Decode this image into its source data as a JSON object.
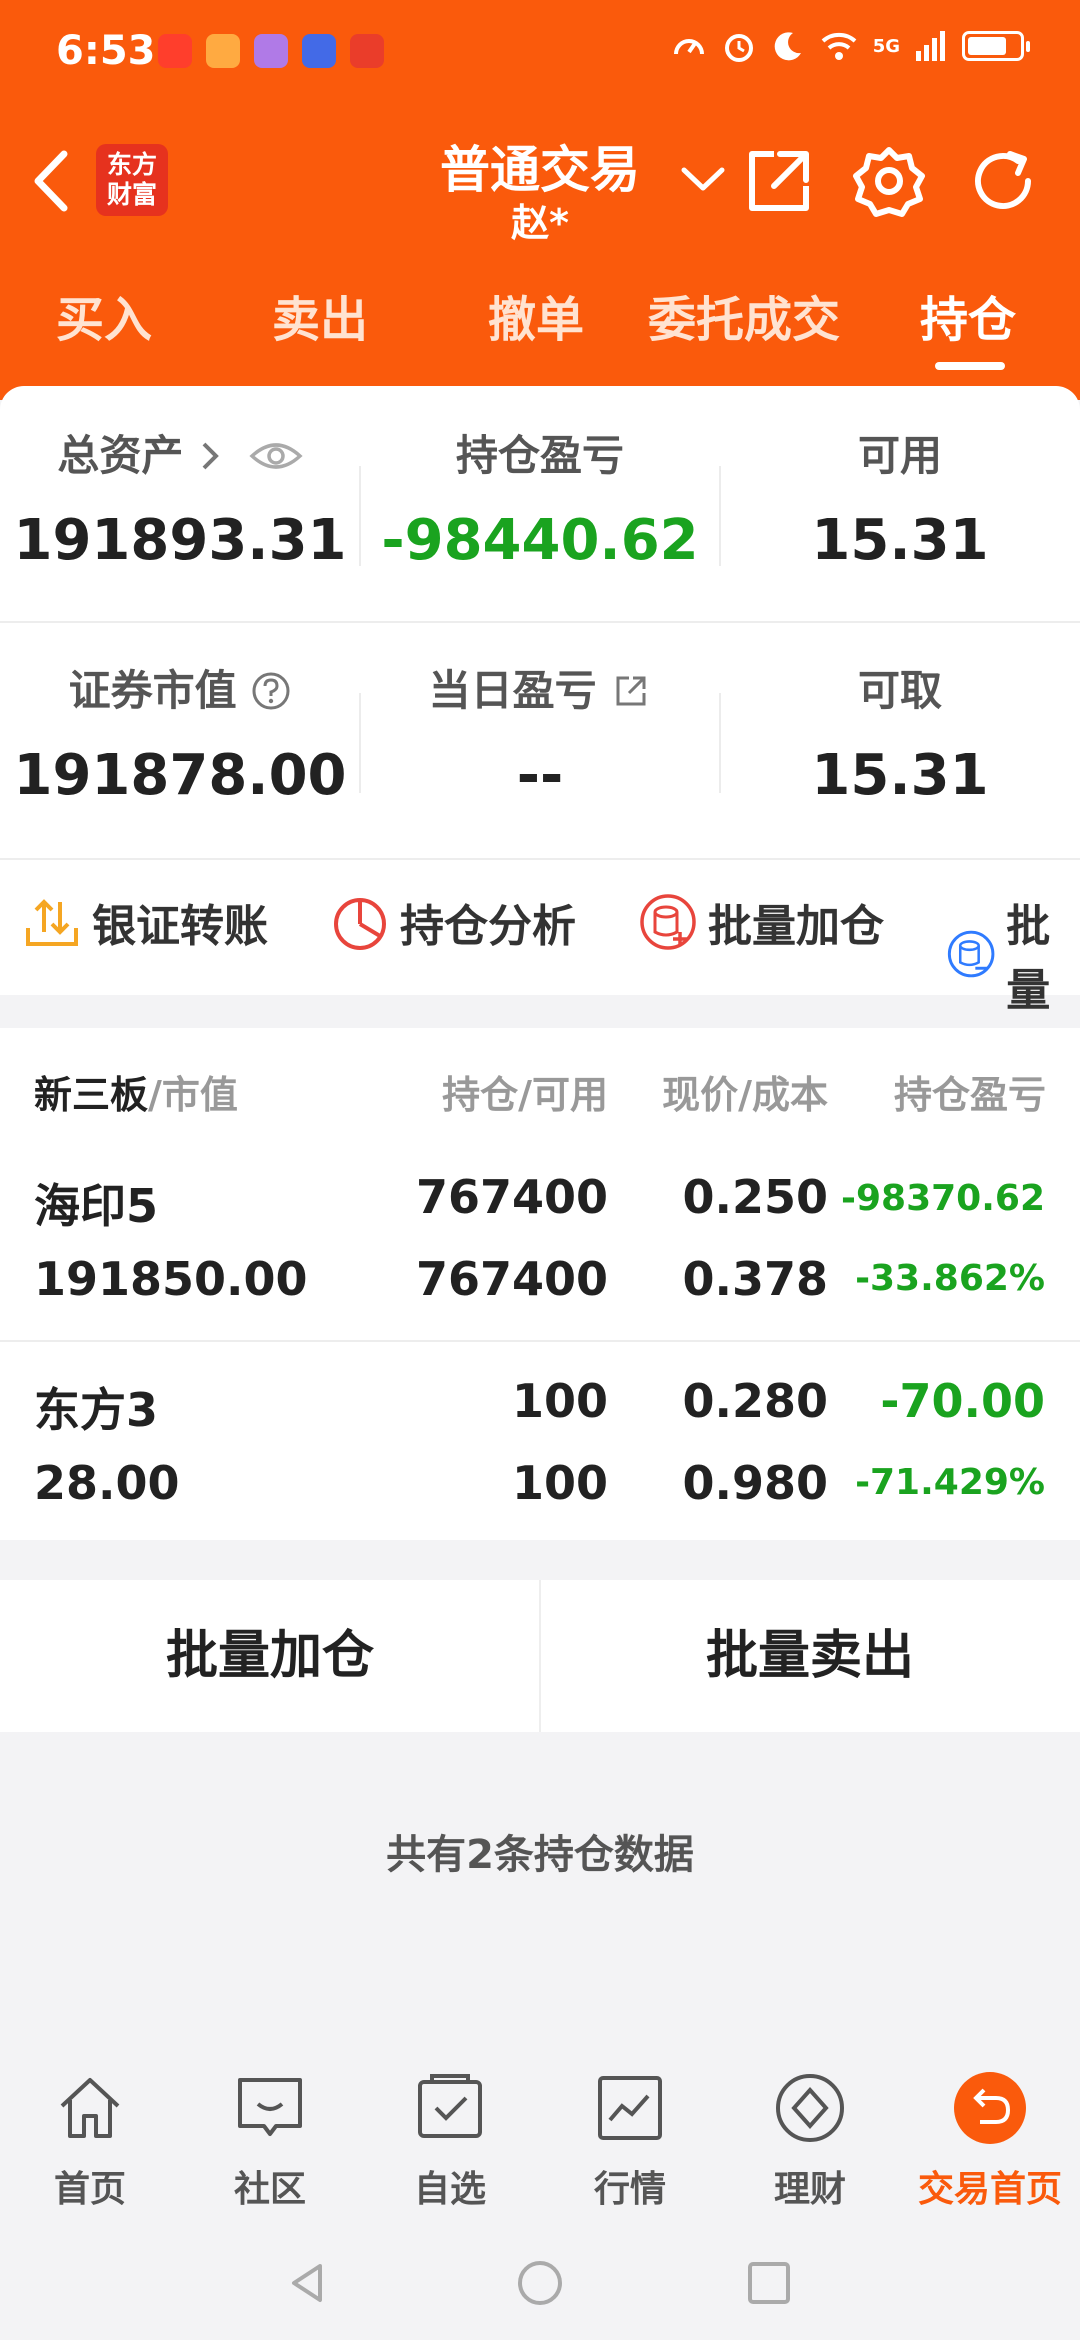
{
  "status_bar": {
    "time": "6:53",
    "network": "5G"
  },
  "header": {
    "logo_line1": "东方",
    "logo_line2": "财富",
    "title": "普通交易",
    "account": "赵*"
  },
  "tabs": [
    "买入",
    "卖出",
    "撤单",
    "委托成交",
    "持仓"
  ],
  "summary": {
    "total_assets_label": "总资产",
    "total_assets": "191893.31",
    "position_pnl_label": "持仓盈亏",
    "position_pnl": "-98440.62",
    "available_label": "可用",
    "available": "15.31",
    "market_value_label": "证券市值",
    "market_value": "191878.00",
    "daily_pnl_label": "当日盈亏",
    "daily_pnl": "--",
    "withdrawable_label": "可取",
    "withdrawable": "15.31"
  },
  "actions": [
    "银证转账",
    "持仓分析",
    "批量加仓",
    "批量"
  ],
  "holdings_header": {
    "col1_a": "新三板",
    "col1_b": "/市值",
    "col2": "持仓/可用",
    "col3": "现价/成本",
    "col4": "持仓盈亏"
  },
  "holdings": [
    {
      "name": "海印5",
      "market_value": "191850.00",
      "position": "767400",
      "available": "767400",
      "price": "0.250",
      "cost": "0.378",
      "pnl": "-98370.62",
      "pnl_pct": "-33.862%"
    },
    {
      "name": "东方3",
      "market_value": "28.00",
      "position": "100",
      "available": "100",
      "price": "0.280",
      "cost": "0.980",
      "pnl": "-70.00",
      "pnl_pct": "-71.429%"
    }
  ],
  "batch": {
    "add": "批量加仓",
    "sell": "批量卖出"
  },
  "count_text": "共有2条持仓数据",
  "bottom_nav": [
    "首页",
    "社区",
    "自选",
    "行情",
    "理财",
    "交易首页"
  ],
  "colors": {
    "brand": "#fa5a0c",
    "loss_green": "#1aa31f"
  }
}
